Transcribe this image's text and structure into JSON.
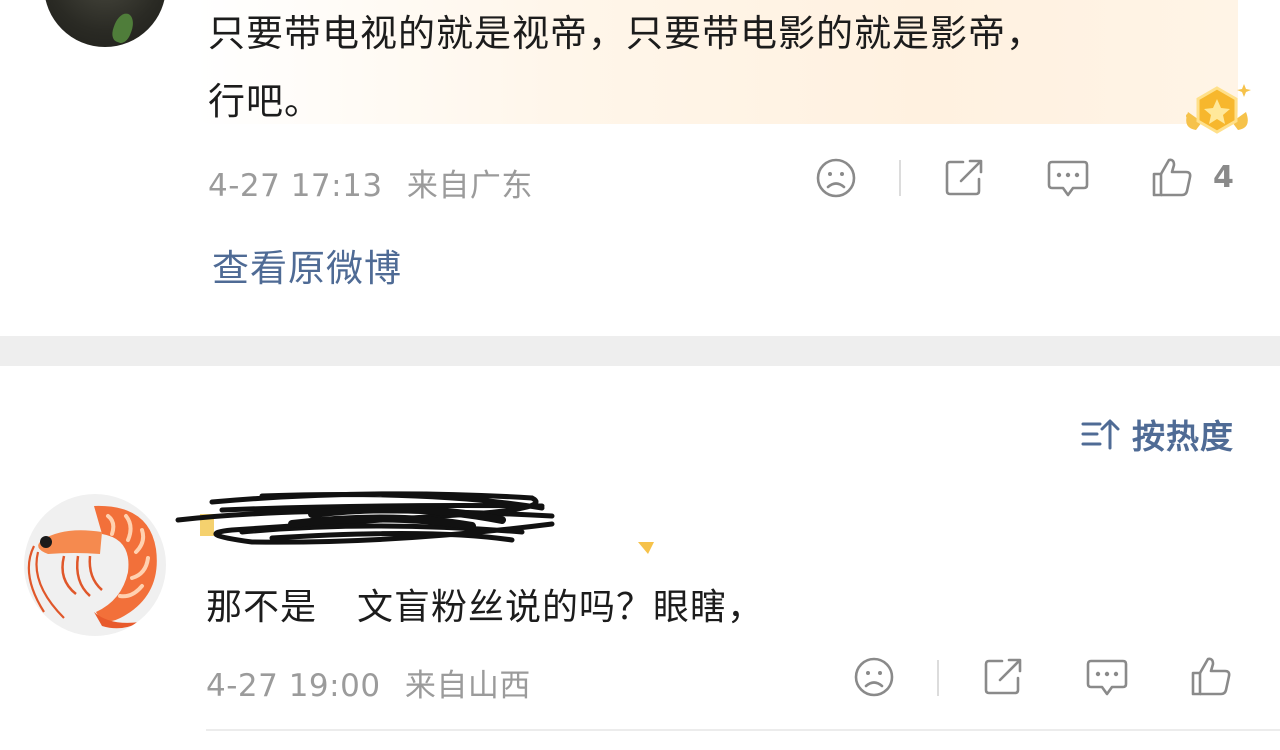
{
  "comment1": {
    "text_line1": "只要带电视的就是视帝，只要带电影的就是影帝，",
    "text_line2": "行吧。",
    "time": "4-27 17:13",
    "location": "来自广东",
    "likes": "4",
    "view_original": "查看原微博"
  },
  "sort": {
    "label": "按热度"
  },
  "comment2": {
    "text_before": "那不是",
    "text_after": "文盲粉丝说的吗？眼瞎，",
    "time": "4-27 19:00",
    "location": "来自山西"
  },
  "colors": {
    "link": "#4f6b95",
    "meta": "#9b9b9b",
    "icon": "#8a8a8a",
    "band": "#eeeeee"
  },
  "icons": [
    "sad-face-icon",
    "share-icon",
    "comment-icon",
    "thumbs-up-icon",
    "sort-icon",
    "crown-badge-icon"
  ]
}
